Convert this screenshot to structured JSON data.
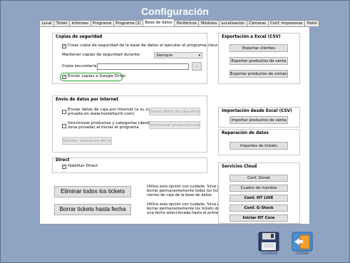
{
  "window": {
    "title": "Configuración"
  },
  "tabs": [
    "Local",
    "Ticket",
    "Informes",
    "Programa",
    "Programa (2)",
    "Base de datos",
    "Periféricos",
    "Módulos",
    "Localización",
    "Cámaras",
    "Conf. Impresoras",
    "Hotel"
  ],
  "backup": {
    "title": "Copias de seguridad",
    "create_copy_label": "Crear copia de seguridad de la base de datos al ejecutar el programa (recomendado)",
    "create_copy_checked": true,
    "keep_label": "Mantener copias de seguridad durante:",
    "keep_value": "Siempre",
    "secondary_label": "Copia secundaria:",
    "secondary_value": "",
    "browse_label": "...",
    "google_drive_label": "Enviar copias a Google Drive",
    "google_drive_checked": true
  },
  "internet": {
    "title": "Envío de datos por Internet",
    "send_cash_label_1": "Enviar datos de caja por Internet (a su zona",
    "send_cash_label_2": "privada en www.hosteltactil.com)",
    "send_cash_checked": false,
    "send_cash_button": "Enviar datos de caja ahora",
    "sync_label_1": "Sincronizar productos y categorías (desde su",
    "sync_label_2": "zona privada) al iniciar el programa",
    "sync_checked": false,
    "sync_button": "Sincronizar productos ahora",
    "request_button": "Solicitar activación del local"
  },
  "direct": {
    "title": "Direct",
    "enable_label": "Habilitar Direct",
    "enable_checked": true
  },
  "delete": {
    "delete_all_button": "Eliminar todos los tickets",
    "delete_all_desc_1": "Utilice esta opción con cuidado. Sirve para",
    "delete_all_desc_2": "borrar permanentemente todos los tickets y",
    "delete_all_desc_3": "cierres de caja de la base de datos.",
    "delete_until_button": "Borrar tickets hasta fecha",
    "delete_until_desc_1": "Utilice esta opción con cuidado. Sirve para",
    "delete_until_desc_2": "borrar permanentemente los tickets desde",
    "delete_until_desc_3": "una fecha seleccionada hasta el primero."
  },
  "export_excel": {
    "title": "Exportación a Excel (CSV)",
    "buttons": [
      "Exportar clientes",
      "Exportar productos de venta",
      "Exportar productos de compra"
    ]
  },
  "import_excel": {
    "title": "Importación desde Excel (CSV)",
    "button": "Importar productos de venta"
  },
  "repair": {
    "title": "Reparación de datos",
    "button": "Importes de tickets"
  },
  "cloud": {
    "title": "Servicios Cloud",
    "buttons": [
      "Conf. Gimet",
      "Cuadro de mandos",
      "Conf. HT LIVE",
      "Conf. G-Stock",
      "Iniciar HT Core"
    ]
  },
  "footer": {
    "save_label": "GUARDAR",
    "close_label": "CERRAR"
  }
}
